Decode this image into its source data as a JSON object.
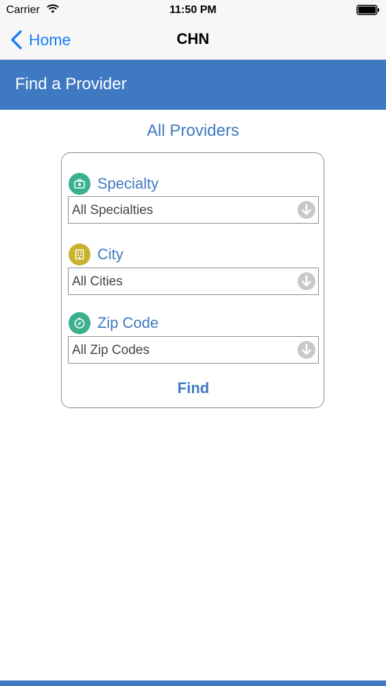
{
  "status_bar": {
    "carrier": "Carrier",
    "time": "11:50 PM"
  },
  "nav": {
    "back_label": "Home",
    "title": "CHN"
  },
  "header": {
    "title": "Find a Provider"
  },
  "main": {
    "subtitle": "All Providers",
    "fields": [
      {
        "label": "Specialty",
        "value": "All Specialties",
        "icon": "briefcase-icon",
        "color": "#3bb08f"
      },
      {
        "label": "City",
        "value": "All Cities",
        "icon": "building-icon",
        "color": "#c9b22c"
      },
      {
        "label": "Zip Code",
        "value": "All Zip Codes",
        "icon": "compass-icon",
        "color": "#3bb08f"
      }
    ],
    "find_label": "Find"
  },
  "colors": {
    "accent": "#3f79c1",
    "ios_blue": "#1a7ef7"
  }
}
